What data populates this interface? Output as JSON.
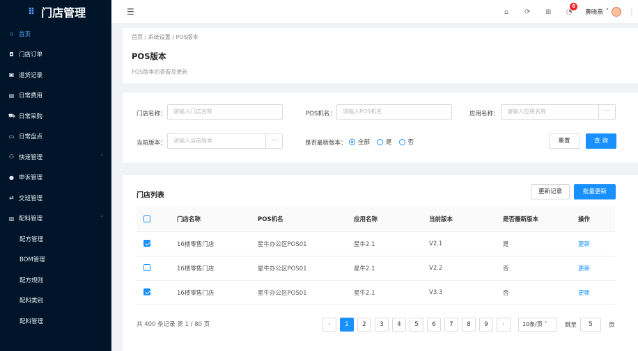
{
  "app": {
    "title": "门店管理",
    "grid_icon": "grid-icon"
  },
  "sidebar": {
    "items": [
      {
        "label": "首页",
        "icon": "home-icon",
        "glyph": "⌂"
      },
      {
        "label": "门店订单",
        "icon": "order-icon",
        "glyph": "◘"
      },
      {
        "label": "退货记录",
        "icon": "return-icon",
        "glyph": "▣"
      },
      {
        "label": "日常费用",
        "icon": "expense-icon",
        "glyph": "▤"
      },
      {
        "label": "日常采购",
        "icon": "purchase-icon",
        "glyph": "⛟"
      },
      {
        "label": "日常盘点",
        "icon": "inventory-icon",
        "glyph": "▭"
      },
      {
        "label": "快速管理",
        "icon": "fast-icon",
        "glyph": "⚇"
      },
      {
        "label": "申诉管理",
        "icon": "appeal-icon",
        "glyph": "●"
      },
      {
        "label": "交班管理",
        "icon": "shift-icon",
        "glyph": "⇄"
      },
      {
        "label": "配料管理",
        "icon": "material-icon",
        "glyph": "▥"
      }
    ],
    "sub_items": [
      {
        "label": "配方管理"
      },
      {
        "label": "BOM管理"
      },
      {
        "label": "配方规则"
      },
      {
        "label": "配料类别"
      },
      {
        "label": "配料管理"
      }
    ],
    "expand_arrow": "˅",
    "collapse_arrow": "˄"
  },
  "topbar": {
    "menu_toggle": "☰",
    "icons": [
      {
        "name": "home-icon",
        "glyph": "⌂"
      },
      {
        "name": "refresh-icon",
        "glyph": "⟳"
      },
      {
        "name": "apps-icon",
        "glyph": "⊞"
      },
      {
        "name": "bell-icon",
        "glyph": "🔔"
      }
    ],
    "notification_count": "6",
    "username": "黄晓燕",
    "user_caret": "˅",
    "more": "⋮"
  },
  "page": {
    "breadcrumb": "首页 / 系统设置 / POS版本",
    "title": "POS版本",
    "description": "POS版本的查看及更新"
  },
  "filter": {
    "store_label": "门店名称：",
    "store_placeholder": "请输入门店名称",
    "pos_label": "POS机名：",
    "pos_placeholder": "请输入POS机名",
    "app_label": "应用名称：",
    "app_placeholder": "请输入应用名称",
    "version_label": "当前版本：",
    "version_placeholder": "请输入当前版本",
    "latest_label": "是否最新版本：",
    "latest_options": [
      "全部",
      "是",
      "否"
    ],
    "latest_selected": "全部",
    "dots": "···",
    "reset": "重置",
    "query": "查 询"
  },
  "table": {
    "title": "门店列表",
    "history_button": "更新记录",
    "batch_button": "批量更新",
    "columns": [
      "门店名称",
      "POS机名",
      "应用名称",
      "当前版本",
      "是否最新版本",
      "操作"
    ],
    "rows": [
      {
        "checked": true,
        "store": "16楼零售门店",
        "pos": "星牛办公区POS01",
        "app": "星牛2.1",
        "version": "V2.1",
        "latest": "是",
        "action": "更新"
      },
      {
        "checked": false,
        "store": "16楼零售门店",
        "pos": "星牛办公区POS01",
        "app": "星牛2.1",
        "version": "V2.2",
        "latest": "否",
        "action": "更新"
      },
      {
        "checked": true,
        "store": "16楼零售门店",
        "pos": "星牛办公区POS01",
        "app": "星牛2.1",
        "version": "V3.3",
        "latest": "否",
        "action": "更新"
      }
    ],
    "header_checked": false
  },
  "pagination": {
    "summary": "共 400 条记录 第 1 / 80 页",
    "prev": "‹",
    "next": "›",
    "pages": [
      "1",
      "2",
      "3",
      "4",
      "5",
      "6",
      "7",
      "8",
      "9"
    ],
    "current": "1",
    "page_size": "10条/页 ˅",
    "jump_label": "跳至",
    "jump_value": "5",
    "jump_suffix": "页"
  },
  "colors": {
    "sidebar_bg": "#001529",
    "primary": "#1890ff",
    "badge": "#f5222d"
  }
}
